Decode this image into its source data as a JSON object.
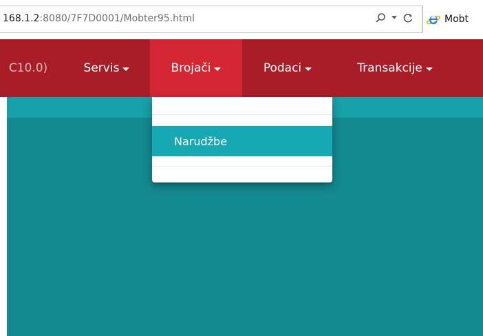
{
  "browser": {
    "url_host": "168.1.2",
    "url_rest": ":8080/7F7D0001/Mobter95.html",
    "search_glyph": "⌕",
    "dropdown_glyph": "▾",
    "refresh_glyph": "↻",
    "tab_title": "Mobt"
  },
  "navbar": {
    "items": [
      {
        "label": "C10.0)"
      },
      {
        "label": "Servis"
      },
      {
        "label": "Brojači"
      },
      {
        "label": "Podaci"
      },
      {
        "label": "Transakcije"
      }
    ],
    "active_index": 2
  },
  "dropdown": {
    "items": [
      {
        "label": "Narudžbe"
      }
    ]
  },
  "colors": {
    "navbar_bg": "#a81d27",
    "nav_active_bg": "#d42633",
    "content_bg": "#138a90",
    "content_strip": "#16a1a8",
    "dropdown_highlight": "#16a9b3"
  }
}
